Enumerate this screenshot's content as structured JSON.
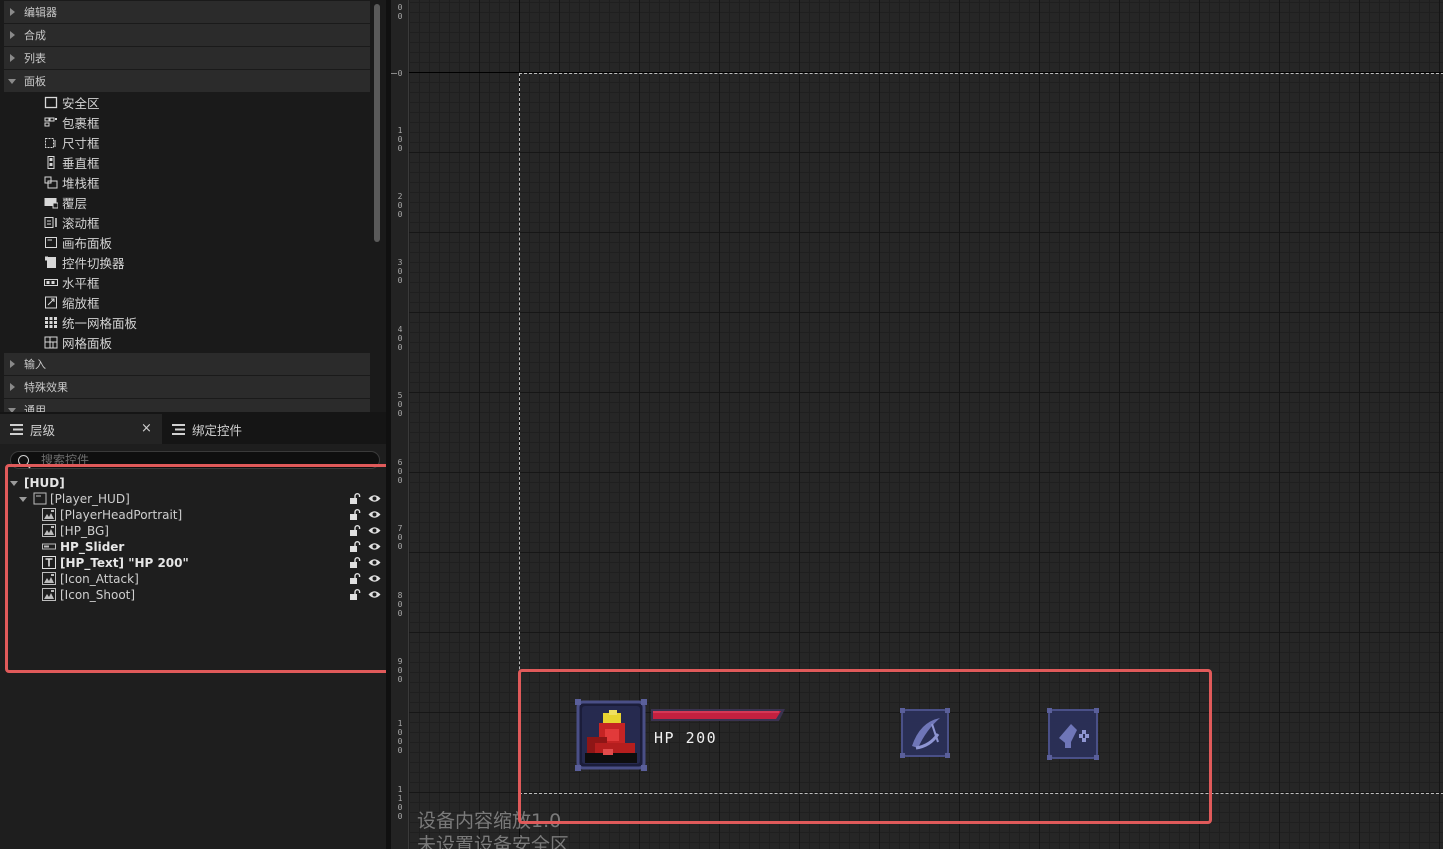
{
  "palette": {
    "categories": [
      {
        "label": "编辑器",
        "expanded": false
      },
      {
        "label": "合成",
        "expanded": false
      },
      {
        "label": "列表",
        "expanded": false
      },
      {
        "label": "面板",
        "expanded": true
      },
      {
        "label": "输入",
        "expanded": false
      },
      {
        "label": "特殊效果",
        "expanded": false
      },
      {
        "label": "通用",
        "expanded": true
      }
    ],
    "panel_items": [
      {
        "label": "安全区",
        "icon": "safezone-icon"
      },
      {
        "label": "包裹框",
        "icon": "wrapbox-icon"
      },
      {
        "label": "尺寸框",
        "icon": "sizebox-icon"
      },
      {
        "label": "垂直框",
        "icon": "verticalbox-icon"
      },
      {
        "label": "堆栈框",
        "icon": "stackbox-icon"
      },
      {
        "label": "覆层",
        "icon": "overlay-icon"
      },
      {
        "label": "滚动框",
        "icon": "scrollbox-icon"
      },
      {
        "label": "画布面板",
        "icon": "canvaspanel-icon"
      },
      {
        "label": "控件切换器",
        "icon": "widgetswitcher-icon"
      },
      {
        "label": "水平框",
        "icon": "horizontalbox-icon"
      },
      {
        "label": "缩放框",
        "icon": "scalebox-icon"
      },
      {
        "label": "统一网格面板",
        "icon": "uniformgrid-icon"
      },
      {
        "label": "网格面板",
        "icon": "gridpanel-icon"
      }
    ]
  },
  "tabs": {
    "hierarchy_label": "层级",
    "close_glyph": "×",
    "bind_label": "绑定控件"
  },
  "search": {
    "placeholder": "搜索控件"
  },
  "hierarchy": {
    "rows": [
      {
        "label": "[HUD]",
        "bold": true,
        "depth": 0,
        "has_arrow": true,
        "icon": "none",
        "controls": false
      },
      {
        "label": "[Player_HUD]",
        "bold": false,
        "depth": 1,
        "has_arrow": true,
        "icon": "canvas-widget-icon",
        "controls": true
      },
      {
        "label": "[PlayerHeadPortrait]",
        "bold": false,
        "depth": 2,
        "has_arrow": false,
        "icon": "image-widget-icon",
        "controls": true
      },
      {
        "label": "[HP_BG]",
        "bold": false,
        "depth": 2,
        "has_arrow": false,
        "icon": "image-widget-icon",
        "controls": true
      },
      {
        "label": "HP_Slider",
        "bold": true,
        "depth": 2,
        "has_arrow": false,
        "icon": "progressbar-widget-icon",
        "controls": true
      },
      {
        "label": "[HP_Text] \"HP 200\"",
        "bold": true,
        "depth": 2,
        "has_arrow": false,
        "icon": "text-widget-icon",
        "controls": true
      },
      {
        "label": "[Icon_Attack]",
        "bold": false,
        "depth": 2,
        "has_arrow": false,
        "icon": "image-widget-icon",
        "controls": true
      },
      {
        "label": "[Icon_Shoot]",
        "bold": false,
        "depth": 2,
        "has_arrow": false,
        "icon": "image-widget-icon",
        "controls": true
      }
    ]
  },
  "ruler": {
    "labels": [
      "0\n0",
      "0",
      "1\n0\n0",
      "2\n0\n0",
      "3\n0\n0",
      "4\n0\n0",
      "5\n0\n0",
      "6\n0\n0",
      "7\n0\n0",
      "8\n0\n0",
      "9\n0\n0",
      "1\n0\n0\n0",
      "1\n1\n0\n0"
    ]
  },
  "canvas": {
    "hp_text": "HP 200",
    "hp_fill_fraction": 1.0,
    "overlay_line1": "设备内容缩放1.0",
    "overlay_line2": "未设置设备安全区"
  },
  "colors": {
    "highlight_box": "#e05a5a",
    "hp_bar_fill": "#c4203f",
    "icon_frame": "#2a2f55"
  }
}
